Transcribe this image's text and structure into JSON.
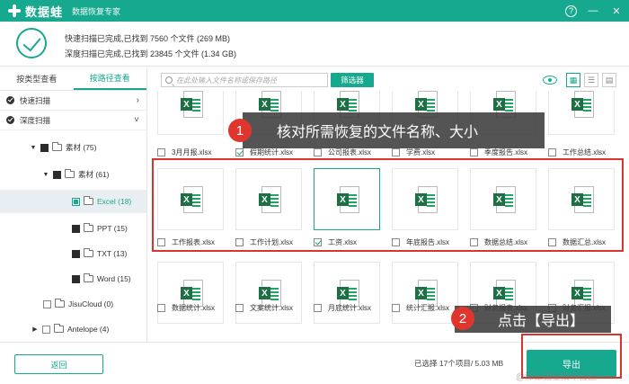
{
  "app": {
    "name": "数据蛙",
    "subtitle": "数据恢复专家",
    "help": "?",
    "minimize": "—",
    "close": "✕"
  },
  "summary": {
    "quick": "快速扫描已完成,已找到 7560 个文件 (269 MB)",
    "deep": "深度扫描已完成,已找到 23845 个文件 (1.34 GB)"
  },
  "tabs": [
    "按类型查看",
    "按路径查看"
  ],
  "tree": {
    "quick_scan": "快速扫描",
    "deep_scan": "深度扫描",
    "items": [
      {
        "label": "素材 (75)",
        "arrow": "▼"
      },
      {
        "label": "素材 (61)",
        "arrow": "▼"
      },
      {
        "label": "Excel (18)",
        "arrow": ""
      },
      {
        "label": "PPT (15)",
        "arrow": ""
      },
      {
        "label": "TXT (13)",
        "arrow": ""
      },
      {
        "label": "Word (15)",
        "arrow": ""
      },
      {
        "label": "JisuCloud (0)",
        "arrow": ""
      },
      {
        "label": "Antelope (4)",
        "arrow": "▶"
      }
    ]
  },
  "toolbar": {
    "search_placeholder": "在此处输入文件名称或保存路径",
    "filter_label": "筛选器"
  },
  "files": {
    "row1": [
      "3月月报.xlsx",
      "假期统计.xlsx",
      "公司报表.xlsx",
      "学费.xlsx",
      "季度报告.xlsx",
      "工作总结.xlsx"
    ],
    "row2": [
      "工作报表.xlsx",
      "工作计划.xlsx",
      "工资.xlsx",
      "年底报告.xlsx",
      "数据总结.xlsx",
      "数据汇总.xlsx"
    ],
    "row3": [
      "数据统计.xlsx",
      "文案统计.xlsx",
      "月底统计.xlsx",
      "统计汇报.xlsx",
      "财务报表.xlsx",
      "财务汇报.xlsx"
    ]
  },
  "annotations": {
    "step1_num": "1",
    "step1_text": "核对所需恢复的文件名称、大小",
    "step2_num": "2",
    "step2_text": "点击【导出】"
  },
  "footer": {
    "back": "返回",
    "selected": "已选择 17个项目/ 5.03 MB",
    "export": "导出",
    "watermark": "@稀土掘金技术社区"
  },
  "colors": {
    "accent": "#17a98f",
    "highlight": "#d9352f"
  }
}
